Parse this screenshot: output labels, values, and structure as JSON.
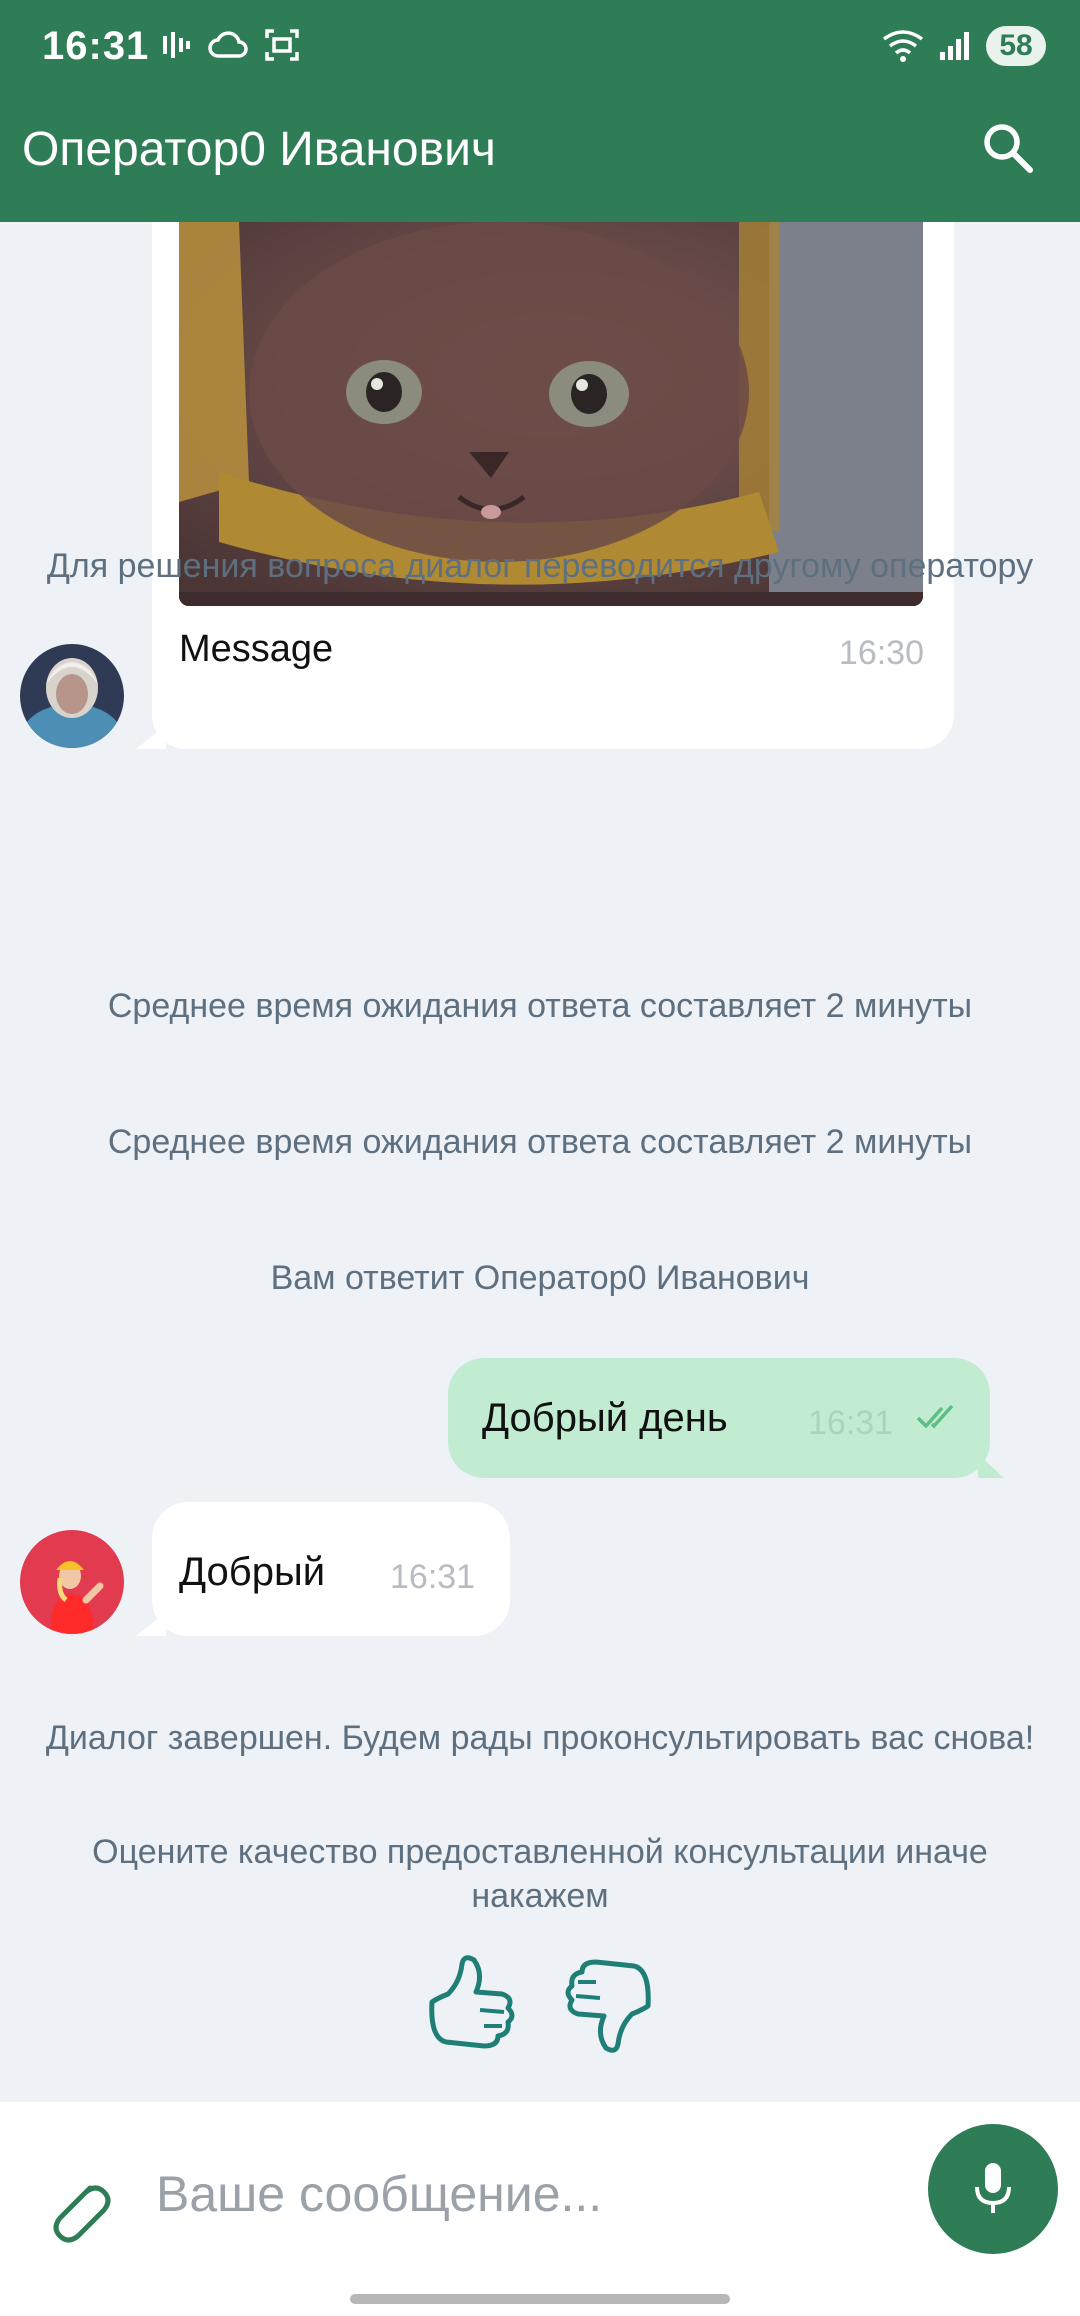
{
  "status_bar": {
    "time": "16:31",
    "battery": "58"
  },
  "header": {
    "title": "Оператор0 Иванович",
    "search_icon": "search-icon"
  },
  "messages": {
    "image_message": {
      "caption": "Message",
      "time": "16:30"
    },
    "system_1": "Для решения вопроса диалог переводится другому оператору",
    "system_2": "Среднее время ожидания ответа составляет 2 минуты",
    "system_3": "Среднее время ожидания ответа составляет 2 минуты",
    "system_4": "Вам ответит Оператор0 Иванович",
    "outgoing": {
      "text": "Добрый день",
      "time": "16:31",
      "status_icon": "double-check-icon"
    },
    "incoming": {
      "text": "Добрый",
      "time": "16:31"
    },
    "system_5": "Диалог завершен. Будем рады проконсультировать вас снова!",
    "rating_prompt": "Оцените качество предоставленной консультации иначе накажем"
  },
  "rating": {
    "like_icon": "thumbs-up-icon",
    "dislike_icon": "thumbs-down-icon"
  },
  "composer": {
    "placeholder": "Ваше сообщение...",
    "attach_icon": "paperclip-icon",
    "mic_icon": "microphone-icon"
  },
  "colors": {
    "brand": "#2e7d57",
    "outgoing_bubble": "#c2ecd1",
    "background": "#eef1f6"
  }
}
